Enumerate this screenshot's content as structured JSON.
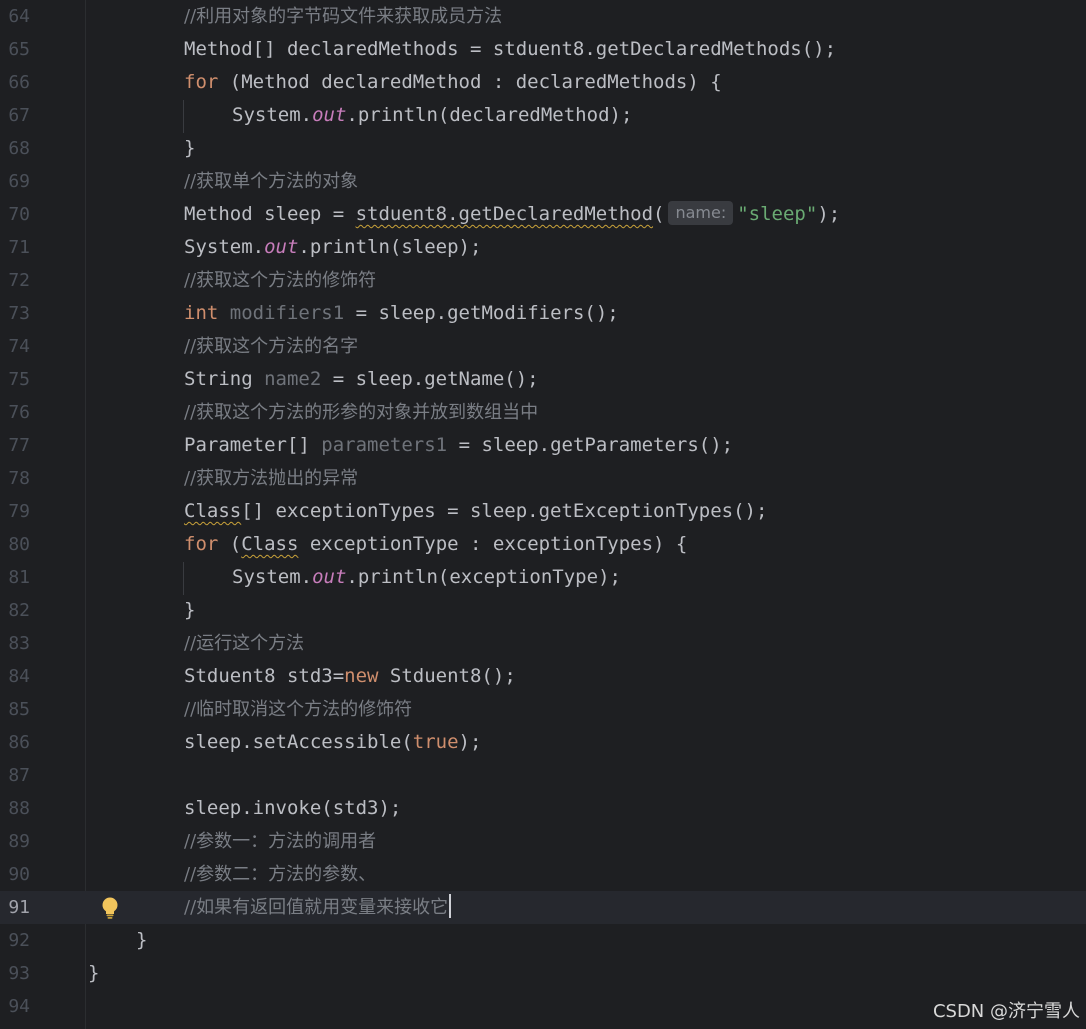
{
  "editor": {
    "lines": [
      {
        "n": "64",
        "comment": "//利用对象的字节码文件来获取成员方法"
      },
      {
        "n": "65",
        "t1": "Method[] declaredMethods = stduent8.getDeclaredMethods();"
      },
      {
        "n": "66",
        "kw": "for",
        "t1": " (Method declaredMethod : declaredMethods) {"
      },
      {
        "n": "67",
        "t1": "System.",
        "fld": "out",
        "t2": ".println(declaredMethod);"
      },
      {
        "n": "68",
        "t1": "}"
      },
      {
        "n": "69",
        "comment": "//获取单个方法的对象"
      },
      {
        "n": "70",
        "t1": "Method sleep = ",
        "warn": "stduent8.getDeclaredMethod",
        "t2": "(",
        "hint": "name:",
        "str": "\"sleep\"",
        "t3": ");"
      },
      {
        "n": "71",
        "t1": "System.",
        "fld": "out",
        "t2": ".println(sleep);"
      },
      {
        "n": "72",
        "comment": "//获取这个方法的修饰符"
      },
      {
        "n": "73",
        "kw": "int",
        "unused": " modifiers1",
        "t1": " = sleep.getModifiers();"
      },
      {
        "n": "74",
        "comment": "//获取这个方法的名字"
      },
      {
        "n": "75",
        "t1": "String",
        "unused": " name2",
        "t2": " = sleep.getName();"
      },
      {
        "n": "76",
        "comment": "//获取这个方法的形参的对象并放到数组当中"
      },
      {
        "n": "77",
        "t1": "Parameter[]",
        "unused": " parameters1",
        "t2": " = sleep.getParameters();"
      },
      {
        "n": "78",
        "comment": "//获取方法抛出的异常"
      },
      {
        "n": "79",
        "warn": "Class",
        "t1": "[] exceptionTypes = sleep.getExceptionTypes();"
      },
      {
        "n": "80",
        "kw": "for",
        "t1": " (",
        "warn": "Class",
        "t2": " exceptionType : exceptionTypes) {"
      },
      {
        "n": "81",
        "t1": "System.",
        "fld": "out",
        "t2": ".println(exceptionType);"
      },
      {
        "n": "82",
        "t1": "}"
      },
      {
        "n": "83",
        "comment": "//运行这个方法"
      },
      {
        "n": "84",
        "t1": "Stduent8 std3=",
        "kw": "new",
        "t2": " Stduent8();"
      },
      {
        "n": "85",
        "comment": "//临时取消这个方法的修饰符"
      },
      {
        "n": "86",
        "t1": "sleep.setAccessible(",
        "kw": "true",
        "t2": ");"
      },
      {
        "n": "87"
      },
      {
        "n": "88",
        "t1": "sleep.invoke(std3);"
      },
      {
        "n": "89",
        "comment": "//参数一：方法的调用者"
      },
      {
        "n": "90",
        "comment": "//参数二：方法的参数、"
      },
      {
        "n": "91",
        "comment": "//如果有返回值就用变量来接收它"
      },
      {
        "n": "92",
        "t1": "}"
      },
      {
        "n": "93",
        "t1": "}"
      },
      {
        "n": "94"
      }
    ],
    "intention_icon": "lightbulb-icon"
  },
  "watermark": "CSDN @济宁雪人",
  "colors": {
    "background": "#1e1f22",
    "keyword": "#cf8e6d",
    "comment": "#7a7e85",
    "field": "#c77dbb",
    "string": "#6aab73",
    "text": "#bcbec4"
  }
}
